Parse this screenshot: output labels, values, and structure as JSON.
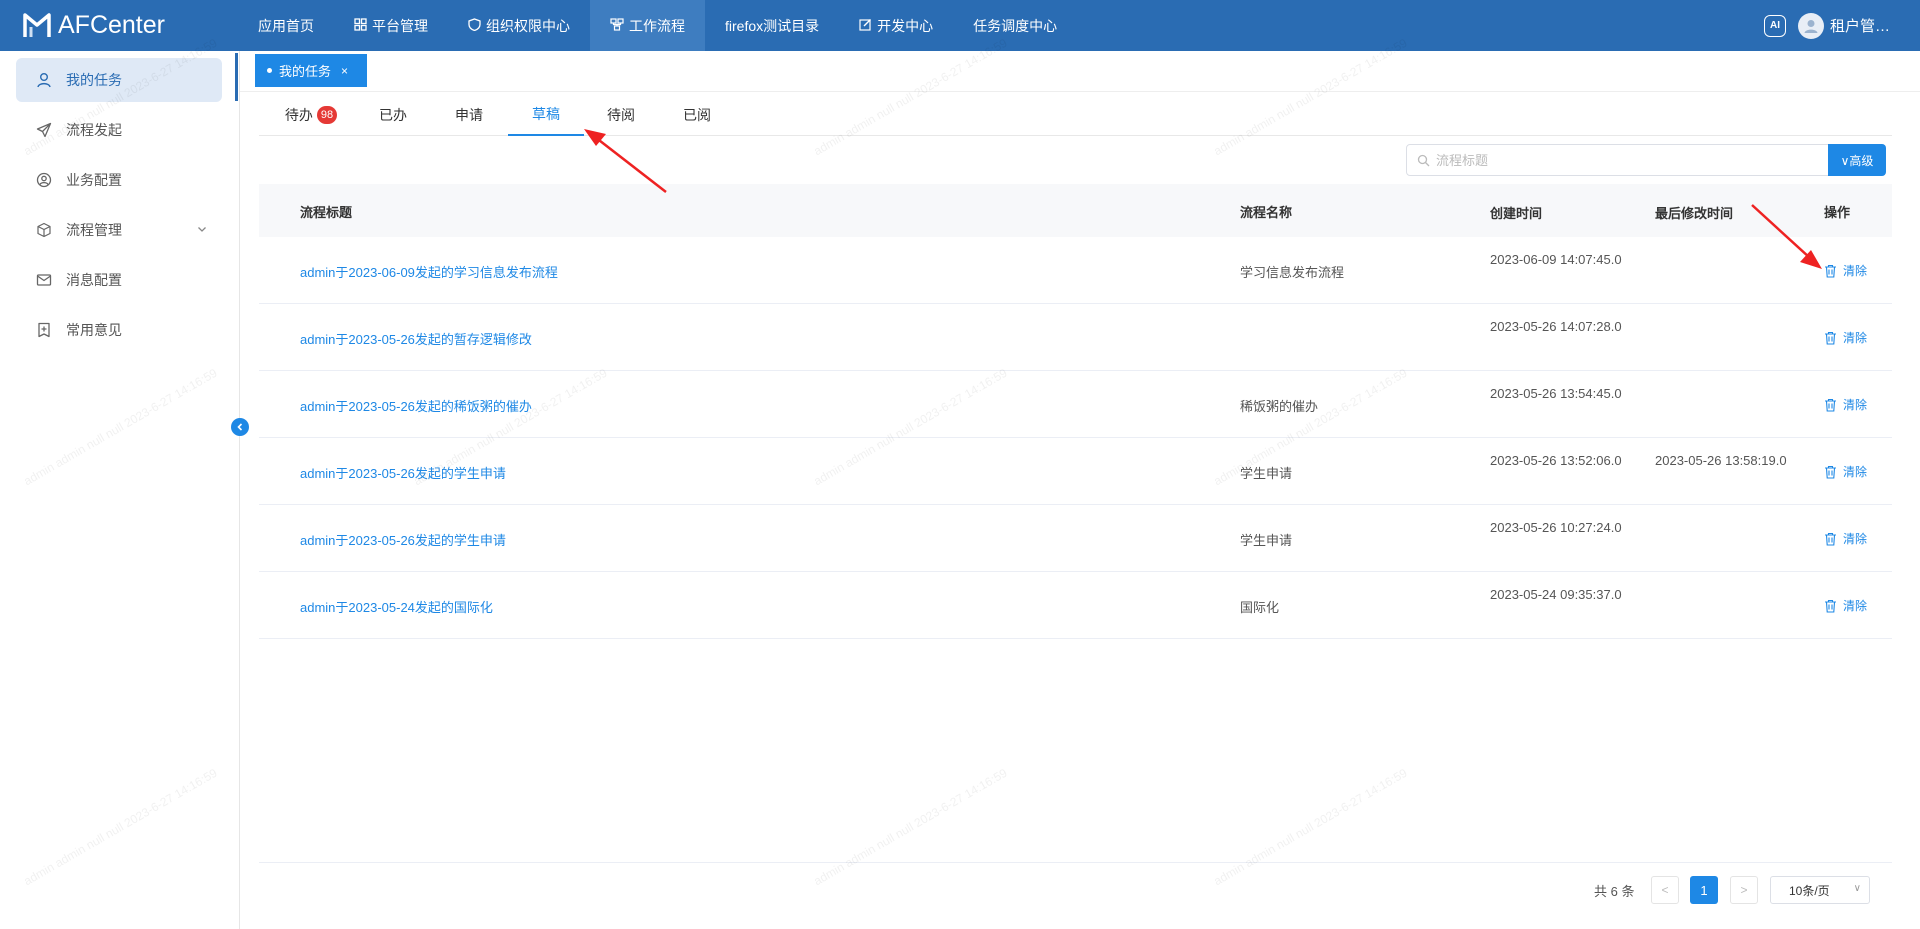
{
  "app": {
    "logo_text": "AFCenter"
  },
  "topnav": [
    {
      "label": "应用首页",
      "icon": ""
    },
    {
      "label": "平台管理",
      "icon": "grid-icon"
    },
    {
      "label": "组织权限中心",
      "icon": "shield-icon"
    },
    {
      "label": "工作流程",
      "icon": "workflow-icon"
    },
    {
      "label": "firefox测试目录",
      "icon": ""
    },
    {
      "label": "开发中心",
      "icon": "edit-icon"
    },
    {
      "label": "任务调度中心",
      "icon": ""
    }
  ],
  "topnav_active": "工作流程",
  "user": {
    "name": "租户管…",
    "ai_label": "AI"
  },
  "sidebar": {
    "items": [
      {
        "label": "我的任务",
        "icon": "user-icon"
      },
      {
        "label": "流程发起",
        "icon": "send-icon"
      },
      {
        "label": "业务配置",
        "icon": "user-circle-icon"
      },
      {
        "label": "流程管理",
        "icon": "cube-icon"
      },
      {
        "label": "消息配置",
        "icon": "mail-icon"
      },
      {
        "label": "常用意见",
        "icon": "plus-square-icon"
      }
    ]
  },
  "page_tab": {
    "label": "我的任务",
    "close": "×"
  },
  "subtabs": [
    {
      "label": "待办",
      "badge": "98"
    },
    {
      "label": "已办"
    },
    {
      "label": "申请"
    },
    {
      "label": "草稿"
    },
    {
      "label": "待阅"
    },
    {
      "label": "已阅"
    }
  ],
  "subtab_active": "草稿",
  "search": {
    "placeholder": "流程标题",
    "advanced_label": "∨高级"
  },
  "table": {
    "columns": [
      "流程标题",
      "流程名称",
      "创建时间",
      "最后修改时间",
      "操作"
    ],
    "rows": [
      {
        "title": "admin于2023-06-09发起的学习信息发布流程",
        "name": "学习信息发布流程",
        "created": "2023-06-09 14:07:45.0",
        "modified": "",
        "action": "清除"
      },
      {
        "title": "admin于2023-05-26发起的暂存逻辑修改",
        "name": "",
        "created": "2023-05-26 14:07:28.0",
        "modified": "",
        "action": "清除"
      },
      {
        "title": "admin于2023-05-26发起的稀饭粥的催办",
        "name": "稀饭粥的催办",
        "created": "2023-05-26 13:54:45.0",
        "modified": "",
        "action": "清除"
      },
      {
        "title": "admin于2023-05-26发起的学生申请",
        "name": "学生申请",
        "created": "2023-05-26 13:52:06.0",
        "modified": "2023-05-26 13:58:19.0",
        "action": "清除"
      },
      {
        "title": "admin于2023-05-26发起的学生申请",
        "name": "学生申请",
        "created": "2023-05-26 10:27:24.0",
        "modified": "",
        "action": "清除"
      },
      {
        "title": "admin于2023-05-24发起的国际化",
        "name": "国际化",
        "created": "2023-05-24 09:35:37.0",
        "modified": "",
        "action": "清除"
      }
    ]
  },
  "pagination": {
    "total_text": "共 6 条",
    "current_page": "1",
    "page_size": "10条/页",
    "prev": "<",
    "next": ">"
  },
  "watermark_text": "admin admin null null 2023-6-27 14:16:59",
  "colors": {
    "topbar": "#2a6cb3",
    "primary": "#1e88e5",
    "badge": "#e53935",
    "arrow": "#ee2222"
  }
}
